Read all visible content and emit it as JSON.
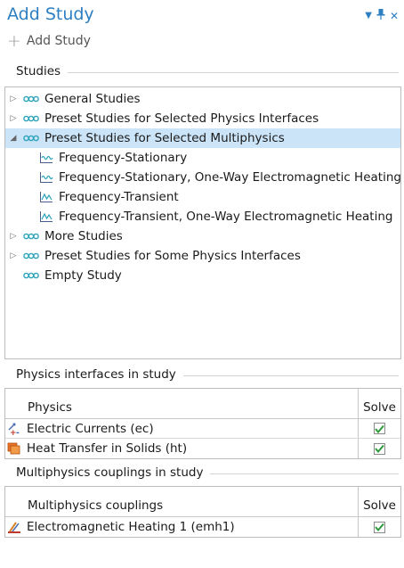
{
  "window": {
    "title": "Add Study",
    "add_study_label": "Add Study"
  },
  "studies": {
    "section_label": "Studies",
    "items": [
      {
        "label": "General Studies",
        "level": 0,
        "expander": "collapsed",
        "icon": "study-icon"
      },
      {
        "label": "Preset Studies for Selected Physics Interfaces",
        "level": 0,
        "expander": "collapsed",
        "icon": "study-icon"
      },
      {
        "label": "Preset Studies for Selected Multiphysics",
        "level": 0,
        "expander": "expanded",
        "icon": "study-icon",
        "selected": true
      },
      {
        "label": "Frequency-Stationary",
        "level": 1,
        "expander": "none",
        "icon": "frequency-stationary-icon"
      },
      {
        "label": "Frequency-Stationary, One-Way Electromagnetic Heating",
        "level": 1,
        "expander": "none",
        "icon": "frequency-stationary-icon"
      },
      {
        "label": "Frequency-Transient",
        "level": 1,
        "expander": "none",
        "icon": "frequency-transient-icon"
      },
      {
        "label": "Frequency-Transient, One-Way Electromagnetic Heating",
        "level": 1,
        "expander": "none",
        "icon": "frequency-transient-icon"
      },
      {
        "label": "More Studies",
        "level": 0,
        "expander": "collapsed",
        "icon": "study-icon"
      },
      {
        "label": "Preset Studies for Some Physics Interfaces",
        "level": 0,
        "expander": "collapsed",
        "icon": "study-icon"
      },
      {
        "label": "Empty Study",
        "level": 0,
        "expander": "none",
        "icon": "study-icon"
      }
    ]
  },
  "physics": {
    "section_label": "Physics interfaces in study",
    "col_name": "Physics",
    "col_solve": "Solve",
    "rows": [
      {
        "name": "Electric Currents (ec)",
        "icon": "electric-currents-icon",
        "solve": true
      },
      {
        "name": "Heat Transfer in Solids (ht)",
        "icon": "heat-transfer-icon",
        "solve": true
      }
    ]
  },
  "multiphysics": {
    "section_label": "Multiphysics couplings in study",
    "col_name": "Multiphysics couplings",
    "col_solve": "Solve",
    "rows": [
      {
        "name": "Electromagnetic Heating 1 (emh1)",
        "icon": "electromagnetic-heating-icon",
        "solve": true
      }
    ]
  },
  "colors": {
    "accent": "#2e7fc2",
    "selection": "#cce4f7",
    "study_icon": "#2aa3b8",
    "check": "#2e9b3a"
  }
}
